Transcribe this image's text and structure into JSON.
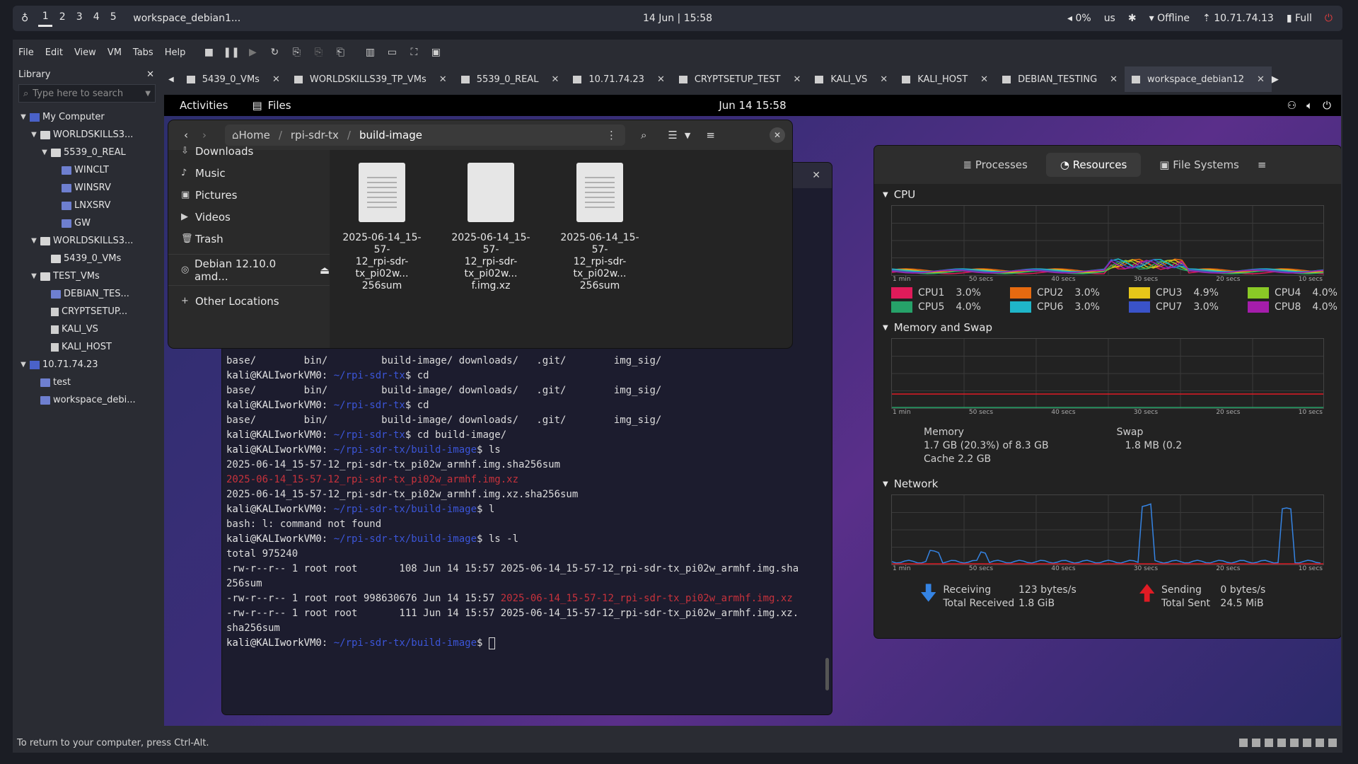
{
  "host_bar": {
    "workspaces": [
      "1",
      "2",
      "3",
      "4",
      "5"
    ],
    "active_workspace": "1",
    "window_title": "workspace_debian1...",
    "clock": "14 Jun | 15:58",
    "volume": "0%",
    "layout": "us",
    "network": "Offline",
    "ip": "10.71.74.13",
    "battery": "Full"
  },
  "menu": [
    "File",
    "Edit",
    "View",
    "VM",
    "Tabs",
    "Help"
  ],
  "library": {
    "title": "Library",
    "search_placeholder": "Type here to search",
    "tree": [
      {
        "label": "My Computer",
        "level": 0,
        "icon": "computer-icon",
        "toggle": "▼"
      },
      {
        "label": "WORLDSKILLS3...",
        "level": 1,
        "icon": "folder-icon",
        "toggle": "▼"
      },
      {
        "label": "5539_0_REAL",
        "level": 2,
        "icon": "folder-icon",
        "toggle": "▼"
      },
      {
        "label": "WINCLT",
        "level": 3,
        "icon": "vm-icon",
        "toggle": ""
      },
      {
        "label": "WINSRV",
        "level": 3,
        "icon": "vm-icon",
        "toggle": ""
      },
      {
        "label": "LNXSRV",
        "level": 3,
        "icon": "vm-icon",
        "toggle": ""
      },
      {
        "label": "GW",
        "level": 3,
        "icon": "vm-icon",
        "toggle": ""
      },
      {
        "label": "WORLDSKILLS3...",
        "level": 1,
        "icon": "folder-icon",
        "toggle": "▼"
      },
      {
        "label": "5439_0_VMs",
        "level": 2,
        "icon": "folder-icon",
        "toggle": ""
      },
      {
        "label": "TEST_VMs",
        "level": 1,
        "icon": "folder-icon",
        "toggle": "▼"
      },
      {
        "label": "DEBIAN_TES...",
        "level": 2,
        "icon": "vm-icon",
        "toggle": ""
      },
      {
        "label": "CRYPTSETUP...",
        "level": 2,
        "icon": "doc-icon",
        "toggle": ""
      },
      {
        "label": "KALI_VS",
        "level": 2,
        "icon": "doc-icon",
        "toggle": ""
      },
      {
        "label": "KALI_HOST",
        "level": 2,
        "icon": "doc-icon",
        "toggle": ""
      },
      {
        "label": "10.71.74.23",
        "level": 0,
        "icon": "computer-icon",
        "toggle": "▼"
      },
      {
        "label": "test",
        "level": 1,
        "icon": "vm-icon",
        "toggle": ""
      },
      {
        "label": "workspace_debi...",
        "level": 1,
        "icon": "vm-icon",
        "toggle": ""
      }
    ]
  },
  "tabs": [
    {
      "label": "5439_0_VMs",
      "active": false
    },
    {
      "label": "WORLDSKILLS39_TP_VMs",
      "active": false
    },
    {
      "label": "5539_0_REAL",
      "active": false
    },
    {
      "label": "10.71.74.23",
      "active": false
    },
    {
      "label": "CRYPTSETUP_TEST",
      "active": false
    },
    {
      "label": "KALI_VS",
      "active": false
    },
    {
      "label": "KALI_HOST",
      "active": false
    },
    {
      "label": "DEBIAN_TESTING",
      "active": false
    },
    {
      "label": "workspace_debian12",
      "active": true
    }
  ],
  "gnome": {
    "activities": "Activities",
    "app": "Files",
    "clock": "Jun 14  15:58"
  },
  "files": {
    "breadcrumb": [
      "Home",
      "rpi-sdr-tx",
      "build-image"
    ],
    "sidebar": [
      {
        "icon": "download-icon",
        "label": "Downloads"
      },
      {
        "icon": "music-icon",
        "label": "Music"
      },
      {
        "icon": "pictures-icon",
        "label": "Pictures"
      },
      {
        "icon": "videos-icon",
        "label": "Videos"
      },
      {
        "icon": "trash-icon",
        "label": "Trash"
      }
    ],
    "drive": "Debian 12.10.0 amd...",
    "other_locations": "Other Locations",
    "items": [
      {
        "line1": "2025-06-14_15-57-",
        "line2": "12_rpi-sdr-",
        "line3": "tx_pi02w... 256sum",
        "lined": true
      },
      {
        "line1": "2025-06-14_15-57-",
        "line2": "12_rpi-sdr-",
        "line3": "tx_pi02w... f.img.xz",
        "lined": false
      },
      {
        "line1": "2025-06-14_15-57-",
        "line2": "12_rpi-sdr-",
        "line3": "tx_pi02w... 256sum",
        "lined": true
      }
    ]
  },
  "terminal": {
    "prompt_user": "kali@KALIworkVM0",
    "lines": [
      {
        "type": "out",
        "text": "base/        bin/         build-image/ downloads/   .git/        img_sig/"
      },
      {
        "type": "prompt",
        "path": "~/rpi-sdr-tx",
        "cmd": "cd"
      },
      {
        "type": "out",
        "text": "base/        bin/         build-image/ downloads/   .git/        img_sig/"
      },
      {
        "type": "prompt",
        "path": "~/rpi-sdr-tx",
        "cmd": "cd"
      },
      {
        "type": "out",
        "text": "base/        bin/         build-image/ downloads/   .git/        img_sig/"
      },
      {
        "type": "prompt",
        "path": "~/rpi-sdr-tx",
        "cmd": "cd build-image/"
      },
      {
        "type": "prompt",
        "path": "~/rpi-sdr-tx/build-image",
        "cmd": "ls"
      },
      {
        "type": "out",
        "text": "2025-06-14_15-57-12_rpi-sdr-tx_pi02w_armhf.img.sha256sum"
      },
      {
        "type": "red",
        "text": "2025-06-14_15-57-12_rpi-sdr-tx_pi02w_armhf.img.xz"
      },
      {
        "type": "out",
        "text": "2025-06-14_15-57-12_rpi-sdr-tx_pi02w_armhf.img.xz.sha256sum"
      },
      {
        "type": "prompt",
        "path": "~/rpi-sdr-tx/build-image",
        "cmd": "l"
      },
      {
        "type": "out",
        "text": "bash: l: command not found"
      },
      {
        "type": "prompt",
        "path": "~/rpi-sdr-tx/build-image",
        "cmd": "ls -l"
      },
      {
        "type": "out",
        "text": "total 975240"
      },
      {
        "type": "out",
        "text": "-rw-r--r-- 1 root root       108 Jun 14 15:57 2025-06-14_15-57-12_rpi-sdr-tx_pi02w_armhf.img.sha"
      },
      {
        "type": "out",
        "text": "256sum"
      },
      {
        "type": "mixed",
        "text": "-rw-r--r-- 1 root root 998630676 Jun 14 15:57 ",
        "red": "2025-06-14_15-57-12_rpi-sdr-tx_pi02w_armhf.img.xz"
      },
      {
        "type": "out",
        "text": "-rw-r--r-- 1 root root       111 Jun 14 15:57 2025-06-14_15-57-12_rpi-sdr-tx_pi02w_armhf.img.xz."
      },
      {
        "type": "out",
        "text": "sha256sum"
      },
      {
        "type": "cursor",
        "path": "~/rpi-sdr-tx/build-image"
      }
    ]
  },
  "sysmon": {
    "tabs": [
      "Processes",
      "Resources",
      "File Systems"
    ],
    "active_tab": "Resources",
    "cpu_title": "CPU",
    "time_ticks": [
      "1 min",
      "50 secs",
      "40 secs",
      "30 secs",
      "20 secs",
      "10 secs"
    ],
    "cpus": [
      {
        "name": "CPU1",
        "value": "3.0%",
        "color": "#e01b5a"
      },
      {
        "name": "CPU2",
        "value": "3.0%",
        "color": "#e66a10"
      },
      {
        "name": "CPU3",
        "value": "4.9%",
        "color": "#e6c619"
      },
      {
        "name": "CPU4",
        "value": "4.0%",
        "color": "#8ac926"
      },
      {
        "name": "CPU5",
        "value": "4.0%",
        "color": "#26a269"
      },
      {
        "name": "CPU6",
        "value": "3.0%",
        "color": "#1fb6c9"
      },
      {
        "name": "CPU7",
        "value": "3.0%",
        "color": "#3a53c9"
      },
      {
        "name": "CPU8",
        "value": "4.0%",
        "color": "#a51dab"
      }
    ],
    "mem_title": "Memory and Swap",
    "memory_label": "Memory",
    "memory_value": "1.7 GB (20.3%) of 8.3 GB",
    "cache": "Cache 2.2 GB",
    "swap_label": "Swap",
    "swap_value": "1.8 MB (0.2",
    "net_title": "Network",
    "receiving_label": "Receiving",
    "receiving_value": "123 bytes/s",
    "total_received_label": "Total Received",
    "total_received_value": "1.8 GiB",
    "sending_label": "Sending",
    "sending_value": "0 bytes/s",
    "total_sent_label": "Total Sent",
    "total_sent_value": "24.5 MiB"
  },
  "status": "To return to your computer, press Ctrl-Alt."
}
